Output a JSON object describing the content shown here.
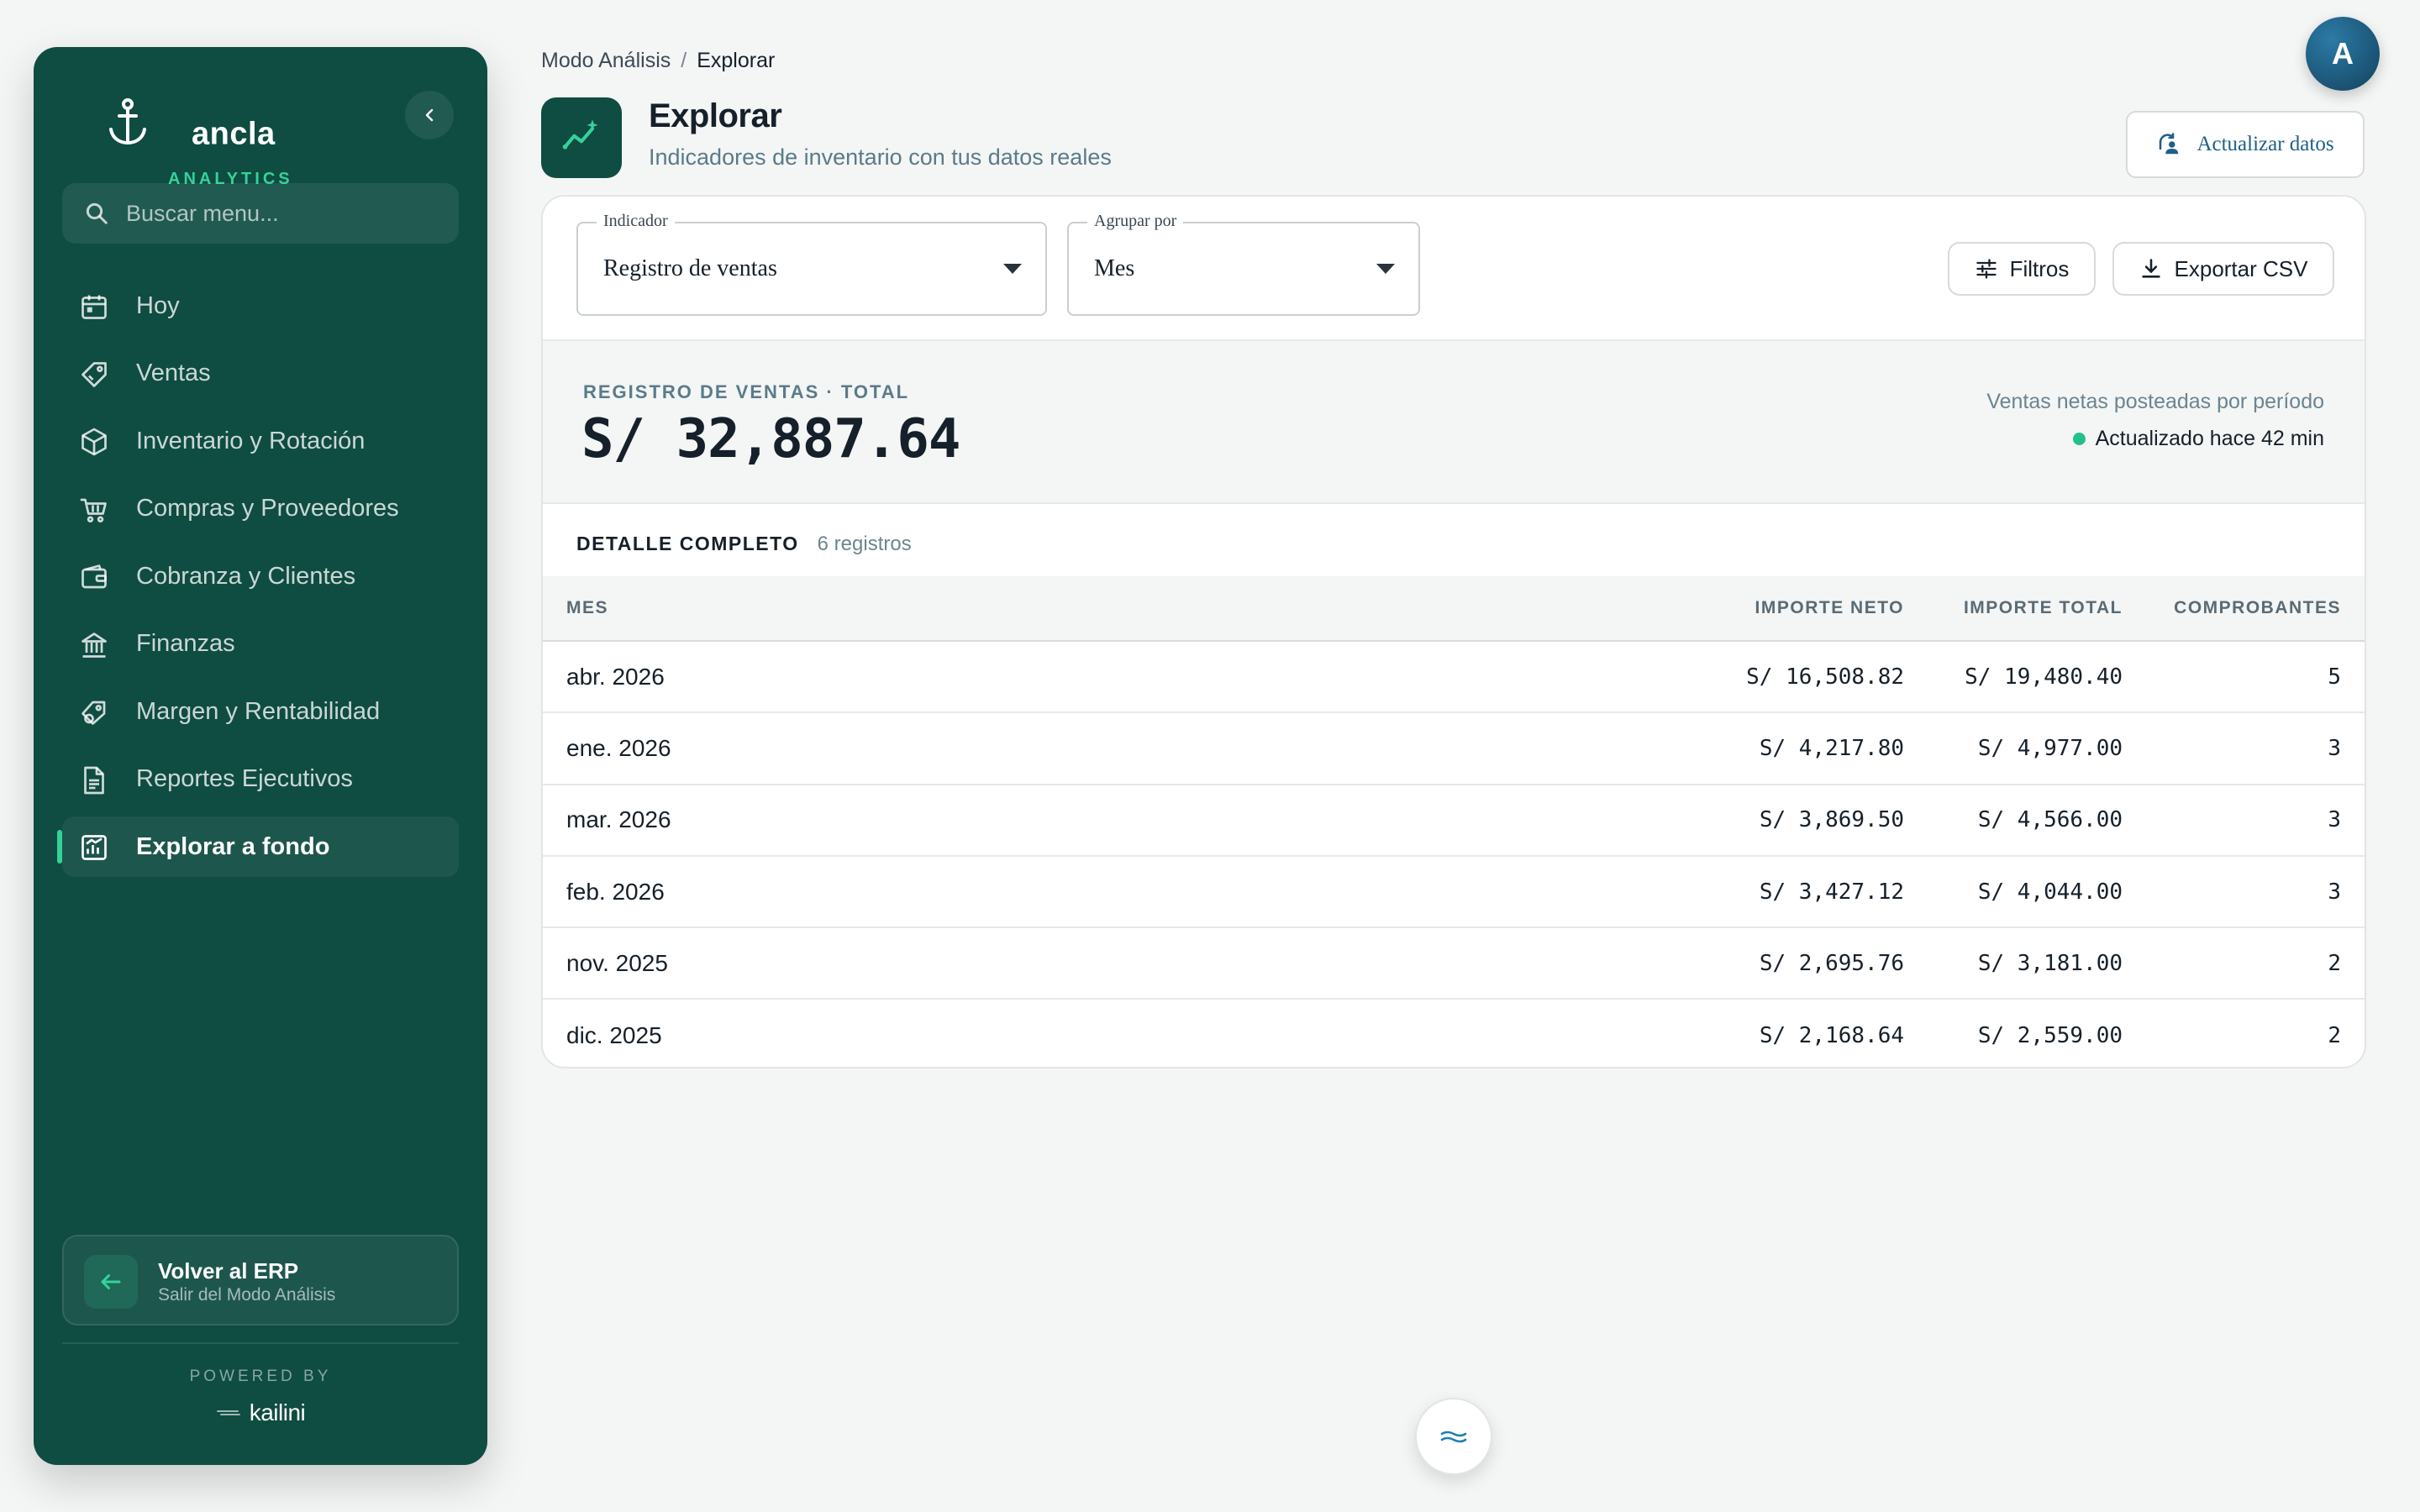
{
  "sidebar": {
    "brand_name": "ancla",
    "brand_sub": "ANALYTICS",
    "search_placeholder": "Buscar menu...",
    "items": [
      {
        "label": "Hoy",
        "icon": "calendar-icon"
      },
      {
        "label": "Ventas",
        "icon": "tag-icon"
      },
      {
        "label": "Inventario y Rotación",
        "icon": "box-icon"
      },
      {
        "label": "Compras y Proveedores",
        "icon": "cart-icon"
      },
      {
        "label": "Cobranza y Clientes",
        "icon": "wallet-icon"
      },
      {
        "label": "Finanzas",
        "icon": "bank-icon"
      },
      {
        "label": "Margen y Rentabilidad",
        "icon": "price-tag-icon"
      },
      {
        "label": "Reportes Ejecutivos",
        "icon": "document-icon"
      },
      {
        "label": "Explorar a fondo",
        "icon": "chart-icon",
        "active": true
      }
    ],
    "back_title": "Volver al ERP",
    "back_sub": "Salir del Modo Análisis",
    "powered_by": "POWERED BY",
    "powered_brand": "kailini"
  },
  "header": {
    "breadcrumb": [
      "Modo Análisis",
      "/",
      "Explorar"
    ],
    "title": "Explorar",
    "subtitle": "Indicadores de inventario con tus datos reales",
    "refresh_label": "Actualizar datos",
    "avatar_initial": "A"
  },
  "controls": {
    "indicator_legend": "Indicador",
    "indicator_value": "Registro de ventas",
    "group_legend": "Agrupar por",
    "group_value": "Mes",
    "filters_label": "Filtros",
    "export_label": "Exportar CSV"
  },
  "summary": {
    "label": "REGISTRO DE VENTAS · TOTAL",
    "value": "S/ 32,887.64",
    "description": "Ventas netas posteadas por período",
    "status": "Actualizado hace 42 min",
    "status_color": "#22c08a"
  },
  "detail": {
    "title": "DETALLE COMPLETO",
    "count": "6 registros",
    "columns": [
      "MES",
      "IMPORTE NETO",
      "IMPORTE TOTAL",
      "COMPROBANTES"
    ],
    "rows": [
      {
        "mes": "abr. 2026",
        "neto": "S/ 16,508.82",
        "total": "S/ 19,480.40",
        "comprobantes": "5"
      },
      {
        "mes": "ene. 2026",
        "neto": "S/ 4,217.80",
        "total": "S/ 4,977.00",
        "comprobantes": "3"
      },
      {
        "mes": "mar. 2026",
        "neto": "S/ 3,869.50",
        "total": "S/ 4,566.00",
        "comprobantes": "3"
      },
      {
        "mes": "feb. 2026",
        "neto": "S/ 3,427.12",
        "total": "S/ 4,044.00",
        "comprobantes": "3"
      },
      {
        "mes": "nov. 2025",
        "neto": "S/ 2,695.76",
        "total": "S/ 3,181.00",
        "comprobantes": "2"
      },
      {
        "mes": "dic. 2025",
        "neto": "S/ 2,168.64",
        "total": "S/ 2,559.00",
        "comprobantes": "2"
      }
    ]
  },
  "colors": {
    "sidebar_bg": "#0f4c42",
    "accent": "#34d399",
    "link": "#1f5f86"
  }
}
